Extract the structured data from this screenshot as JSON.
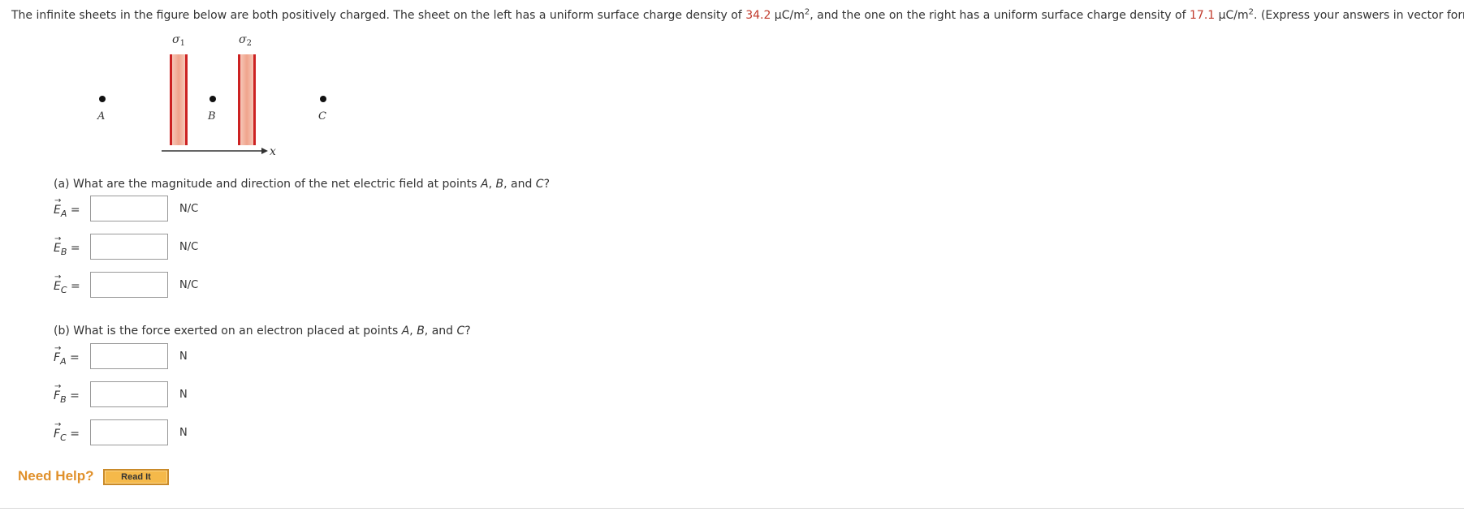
{
  "problem": {
    "text_1": "The infinite sheets in the figure below are both positively charged. The sheet on the left has a uniform surface charge density of ",
    "sigma1_value": "34.2",
    "text_2": " μC/m",
    "text_3": ", and the one on the right has a uniform surface charge density of ",
    "sigma2_value": "17.1",
    "text_4": " μC/m",
    "text_5": ". (Express your answers in vector form.)",
    "exponent": "2"
  },
  "figure": {
    "sigma1_label": "σ",
    "sigma1_sub": "1",
    "sigma2_label": "σ",
    "sigma2_sub": "2",
    "point_a": "A",
    "point_b": "B",
    "point_c": "C",
    "axis_label": "x",
    "sheet_color": "#cc2222",
    "sheet_glow": "#f4b8a8"
  },
  "part_a": {
    "question_prefix": "(a) What are the magnitude and direction of the net electric field at points ",
    "pA": "A",
    "sep1": ", ",
    "pB": "B",
    "sep2": ", and ",
    "pC": "C",
    "q_end": "?",
    "rows": [
      {
        "symbol": "E",
        "sub": "A",
        "eq": "=",
        "value": "",
        "unit": "N/C"
      },
      {
        "symbol": "E",
        "sub": "B",
        "eq": "=",
        "value": "",
        "unit": "N/C"
      },
      {
        "symbol": "E",
        "sub": "C",
        "eq": "=",
        "value": "",
        "unit": "N/C"
      }
    ]
  },
  "part_b": {
    "question_prefix": "(b) What is the force exerted on an electron placed at points ",
    "pA": "A",
    "sep1": ", ",
    "pB": "B",
    "sep2": ", and ",
    "pC": "C",
    "q_end": "?",
    "rows": [
      {
        "symbol": "F",
        "sub": "A",
        "eq": "=",
        "value": "",
        "unit": "N"
      },
      {
        "symbol": "F",
        "sub": "B",
        "eq": "=",
        "value": "",
        "unit": "N"
      },
      {
        "symbol": "F",
        "sub": "C",
        "eq": "=",
        "value": "",
        "unit": "N"
      }
    ]
  },
  "help": {
    "need_help": "Need Help?",
    "read_it": "Read It"
  }
}
